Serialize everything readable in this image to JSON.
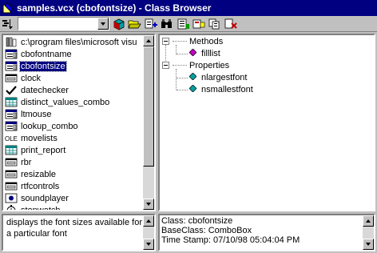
{
  "window": {
    "title": "samples.vcx (cbofontsize) - Class Browser"
  },
  "toolbar": {
    "combo_value": "",
    "buttons": [
      "component-gallery",
      "open",
      "view-additional",
      "find",
      "redefine",
      "clean-up",
      "copy",
      "remove"
    ]
  },
  "class_list": {
    "items": [
      {
        "icon": "library-icon",
        "label": "c:\\program files\\microsoft visu"
      },
      {
        "icon": "combo-class-icon",
        "label": "cbofontname"
      },
      {
        "icon": "combo-class-icon",
        "label": "cbofontsize",
        "selected": true
      },
      {
        "icon": "container-icon",
        "label": "clock"
      },
      {
        "icon": "checkmark-icon",
        "label": "datechecker"
      },
      {
        "icon": "grid-icon",
        "label": "distinct_values_combo"
      },
      {
        "icon": "combo-class-icon",
        "label": "ltmouse"
      },
      {
        "icon": "combo-class-icon",
        "label": "lookup_combo"
      },
      {
        "icon": "ole-icon",
        "label": "movelists"
      },
      {
        "icon": "grid-icon",
        "label": "print_report"
      },
      {
        "icon": "container-icon",
        "label": "rbr"
      },
      {
        "icon": "container-icon",
        "label": "resizable"
      },
      {
        "icon": "container-icon",
        "label": "rtfcontrols"
      },
      {
        "icon": "custom-icon",
        "label": "soundplayer"
      },
      {
        "icon": "stopwatch-icon",
        "label": "stopwatch"
      }
    ]
  },
  "members_tree": {
    "methods_label": "Methods",
    "methods": [
      "filllist"
    ],
    "properties_label": "Properties",
    "properties": [
      "nlargestfont",
      "nsmallestfont"
    ]
  },
  "description": "displays the font sizes available for a particular font",
  "info": {
    "class_line": "Class: cbofontsize",
    "baseclass_line": "BaseClass: ComboBox",
    "timestamp_line": "Time Stamp: 07/10/98 05:04:04 PM"
  },
  "colors": {
    "titlebar": "#000080",
    "selection": "#000080",
    "method_icon": "#c000c0",
    "property_icon": "#00a0a0"
  }
}
